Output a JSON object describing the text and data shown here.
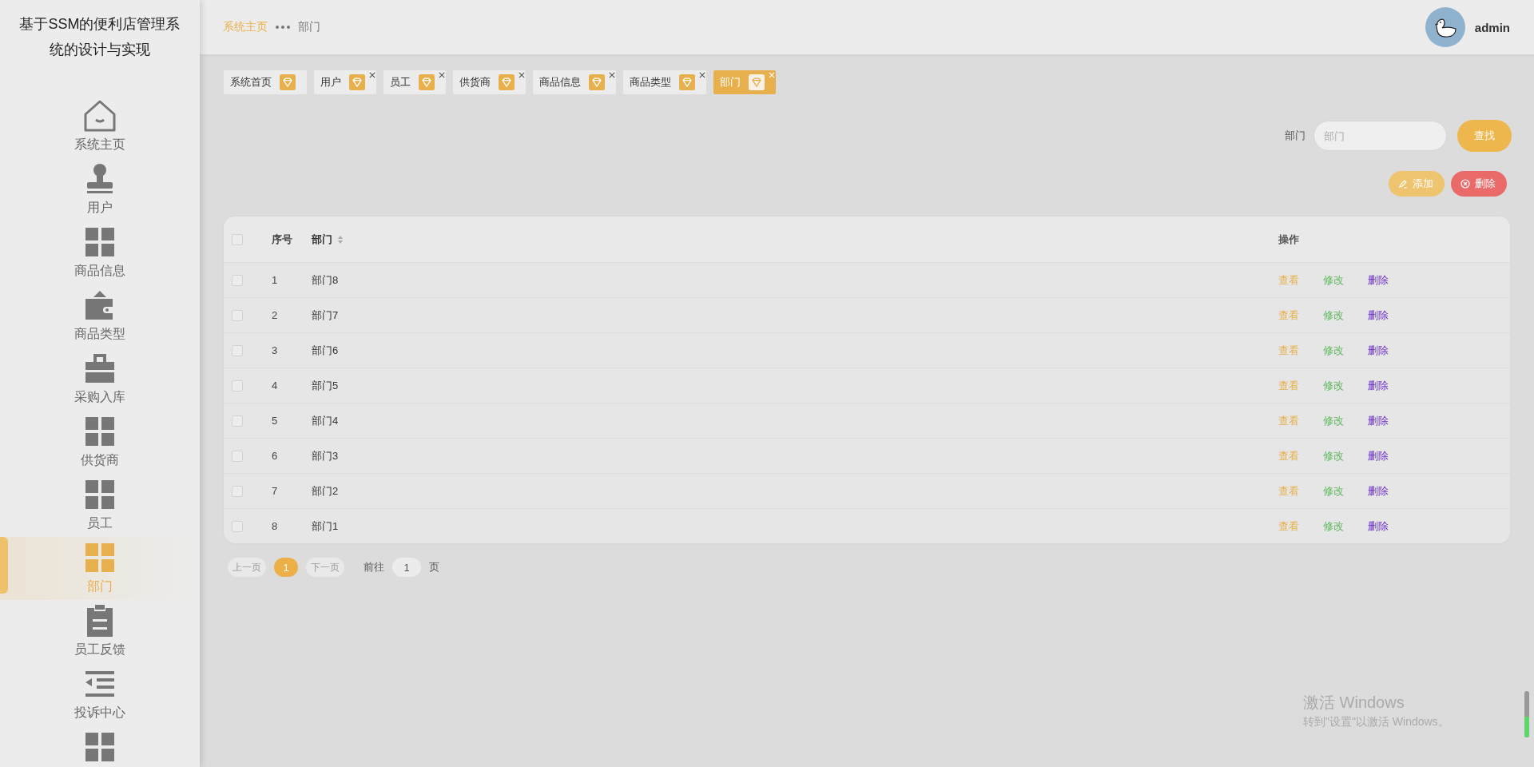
{
  "sidebar": {
    "title": "基于SSM的便利店管理系统的设计与实现",
    "items": [
      {
        "kind": "house",
        "label": "系统主页",
        "selected": false
      },
      {
        "kind": "stamp",
        "label": "用户",
        "selected": false
      },
      {
        "kind": "grid",
        "label": "商品信息",
        "selected": false
      },
      {
        "kind": "wallet",
        "label": "商品类型",
        "selected": false
      },
      {
        "kind": "briefcase",
        "label": "采购入库",
        "selected": false
      },
      {
        "kind": "grid",
        "label": "供货商",
        "selected": false
      },
      {
        "kind": "grid",
        "label": "员工",
        "selected": false
      },
      {
        "kind": "grid",
        "label": "部门",
        "selected": true
      },
      {
        "kind": "clipboard",
        "label": "员工反馈",
        "selected": false
      },
      {
        "kind": "indent",
        "label": "投诉中心",
        "selected": false
      },
      {
        "kind": "grid",
        "selected": false
      }
    ]
  },
  "header": {
    "breadcrumb": [
      "系统主页",
      "部门"
    ],
    "user": "admin"
  },
  "tabs": [
    {
      "label": "系统首页",
      "selected": false,
      "closable": false
    },
    {
      "label": "用户",
      "selected": false,
      "closable": true
    },
    {
      "label": "员工",
      "selected": false,
      "closable": true
    },
    {
      "label": "供货商",
      "selected": false,
      "closable": true
    },
    {
      "label": "商品信息",
      "selected": false,
      "closable": true
    },
    {
      "label": "商品类型",
      "selected": false,
      "closable": true
    },
    {
      "label": "部门",
      "selected": true,
      "closable": true
    }
  ],
  "search": {
    "label": "部门",
    "placeholder": "部门",
    "button": "查找"
  },
  "actions": {
    "add": "添加",
    "delete": "删除"
  },
  "table": {
    "columns": [
      "序号",
      "部门",
      "操作"
    ],
    "rows": [
      {
        "index": "1",
        "name": "部门8",
        "checked": false,
        "actions": [
          "查看",
          "修改",
          "删除"
        ]
      },
      {
        "index": "2",
        "name": "部门7",
        "checked": false,
        "actions": [
          "查看",
          "修改",
          "删除"
        ]
      },
      {
        "index": "3",
        "name": "部门6",
        "checked": false,
        "actions": [
          "查看",
          "修改",
          "删除"
        ]
      },
      {
        "index": "4",
        "name": "部门5",
        "checked": false,
        "actions": [
          "查看",
          "修改",
          "删除"
        ]
      },
      {
        "index": "5",
        "name": "部门4",
        "checked": false,
        "actions": [
          "查看",
          "修改",
          "删除"
        ]
      },
      {
        "index": "6",
        "name": "部门3",
        "checked": false,
        "actions": [
          "查看",
          "修改",
          "删除"
        ]
      },
      {
        "index": "7",
        "name": "部门2",
        "checked": false,
        "actions": [
          "查看",
          "修改",
          "删除"
        ]
      },
      {
        "index": "8",
        "name": "部门1",
        "checked": false,
        "actions": [
          "查看",
          "修改",
          "删除"
        ]
      }
    ],
    "all_checked": false
  },
  "pagination": {
    "prev": "上一页",
    "pages": [
      {
        "label": "1",
        "selected": true
      }
    ],
    "next": "下一页",
    "goto": "前往",
    "goto_value": "1",
    "page_suffix": "页"
  },
  "activation": {
    "title": "激活 Windows",
    "hint": "转到\"设置\"以激活 Windows。"
  }
}
